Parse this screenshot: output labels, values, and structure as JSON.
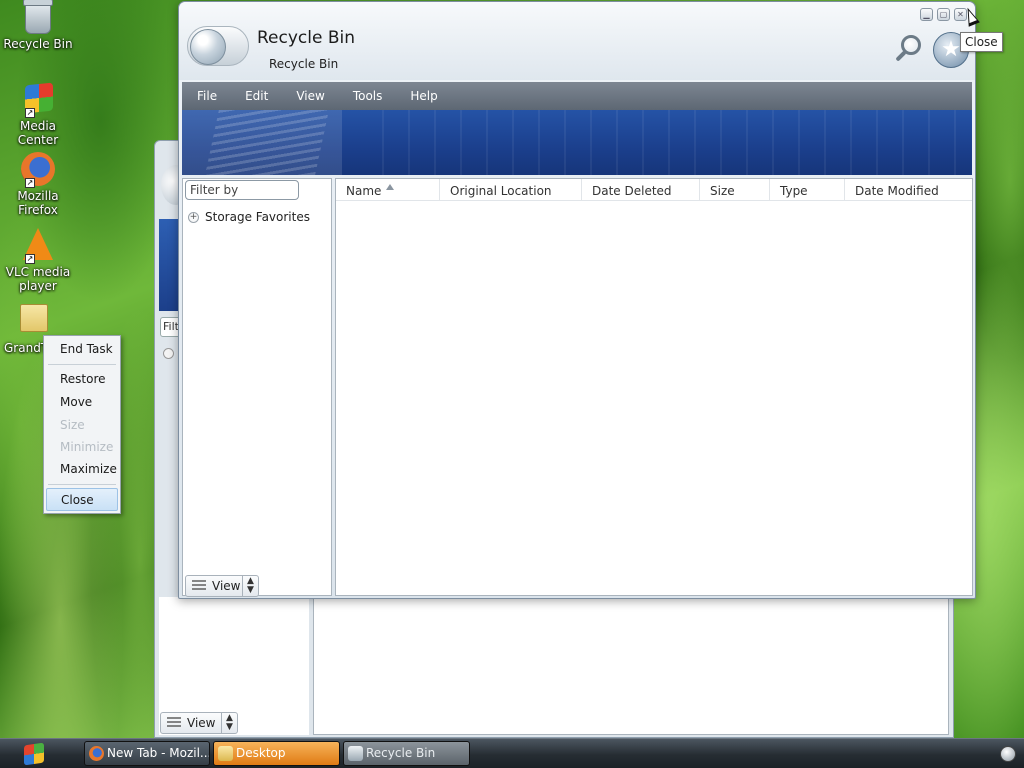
{
  "desktop": {
    "icons": [
      {
        "label": "Recycle Bin",
        "icon": "recycle-bin-icon"
      },
      {
        "label": "Media Center",
        "icon": "media-center-icon"
      },
      {
        "label": "Mozilla Firefox",
        "icon": "firefox-icon"
      },
      {
        "label": "VLC media player",
        "icon": "vlc-icon"
      },
      {
        "label": "GrandT",
        "icon": "folder-zip-icon"
      }
    ]
  },
  "background_window": {
    "filter_text": "Filt",
    "view_label": "View"
  },
  "window": {
    "title": "Recycle Bin",
    "subtitle": "Recycle Bin",
    "tooltip": "Close",
    "menu": [
      "File",
      "Edit",
      "View",
      "Tools",
      "Help"
    ],
    "filter_placeholder": "Filter by",
    "tree": [
      {
        "label": "Storage Favorites",
        "expander": "+"
      }
    ],
    "columns": [
      "Name",
      "Original Location",
      "Date Deleted",
      "Size",
      "Type",
      "Date Modified"
    ],
    "sorted_column": "Name",
    "view_label": "View"
  },
  "context_menu": {
    "items": [
      {
        "label": "End Task",
        "enabled": true
      },
      {
        "label": "Restore",
        "enabled": true
      },
      {
        "label": "Move",
        "enabled": true
      },
      {
        "label": "Size",
        "enabled": false
      },
      {
        "label": "Minimize",
        "enabled": false
      },
      {
        "label": "Maximize",
        "enabled": true
      },
      {
        "label": "Close",
        "enabled": true,
        "highlighted": true
      }
    ]
  },
  "taskbar": {
    "buttons": [
      {
        "label": "New Tab - Mozil...",
        "icon": "firefox-icon"
      },
      {
        "label": "Desktop",
        "icon": "folder-icon",
        "active": true
      },
      {
        "label": "Recycle Bin",
        "icon": "recycle-bin-icon"
      }
    ]
  },
  "colors": {
    "menubar": "#5d6773",
    "banner": "#1b3f8c",
    "taskbar_active": "#e07b14",
    "highlight": "#c9e1f6"
  }
}
